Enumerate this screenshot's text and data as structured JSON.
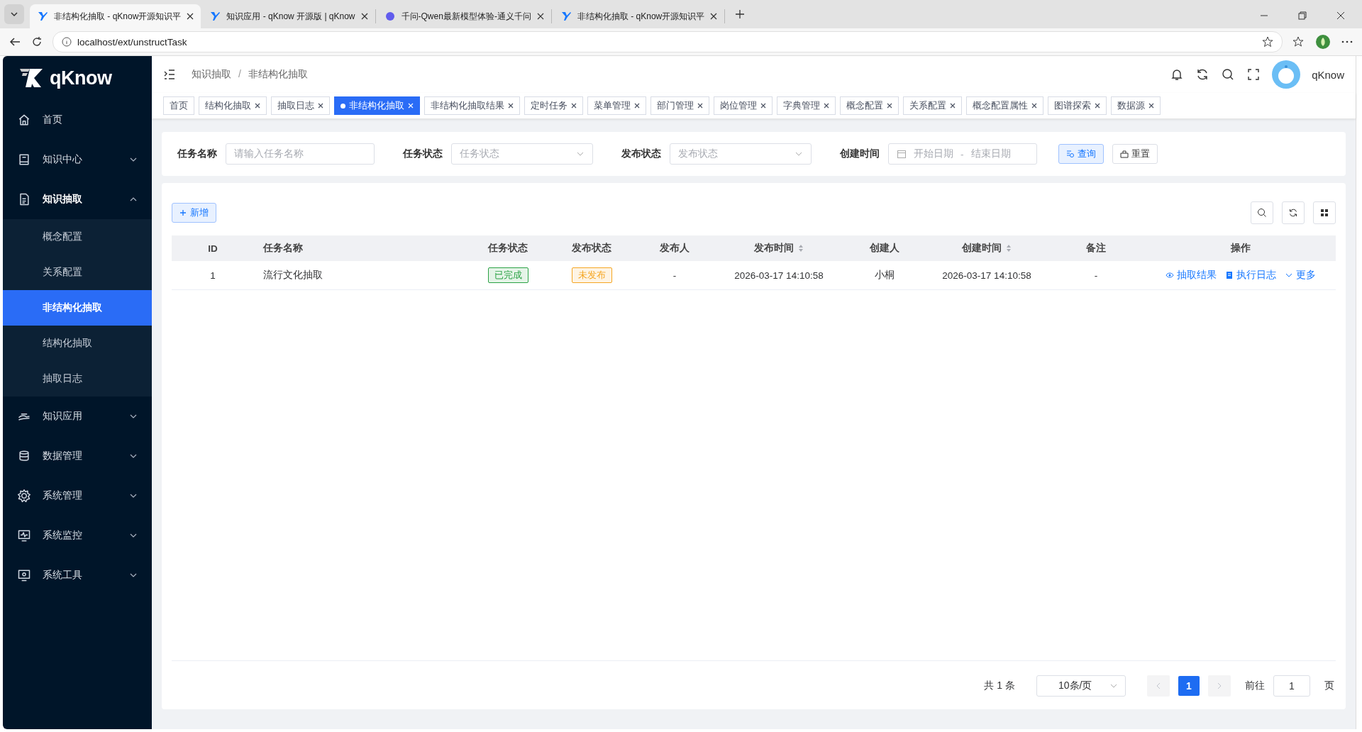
{
  "browser": {
    "tabs": [
      {
        "title": "非结构化抽取 - qKnow开源知识平",
        "selected": true
      },
      {
        "title": "知识应用 - qKnow 开源版 | qKnow",
        "selected": false
      },
      {
        "title": "千问-Qwen最新模型体验-通义千问",
        "selected": false
      },
      {
        "title": "非结构化抽取 - qKnow开源知识平",
        "selected": false
      }
    ],
    "url": "localhost/ext/unstructTask"
  },
  "sidebar": {
    "logo": "qKnow",
    "items": [
      {
        "label": "首页"
      },
      {
        "label": "知识中心",
        "expanded": false
      },
      {
        "label": "知识抽取",
        "expanded": true,
        "children": [
          {
            "label": "概念配置",
            "selected": false
          },
          {
            "label": "关系配置",
            "selected": false
          },
          {
            "label": "非结构化抽取",
            "selected": true
          },
          {
            "label": "结构化抽取",
            "selected": false
          },
          {
            "label": "抽取日志",
            "selected": false
          }
        ]
      },
      {
        "label": "知识应用",
        "expanded": false
      },
      {
        "label": "数据管理",
        "expanded": false
      },
      {
        "label": "系统管理",
        "expanded": false
      },
      {
        "label": "系统监控",
        "expanded": false
      },
      {
        "label": "系统工具",
        "expanded": false
      }
    ]
  },
  "header": {
    "breadcrumb": [
      "知识抽取",
      "非结构化抽取"
    ],
    "breadcrumb_separator": "/",
    "user": "qKnow"
  },
  "tags": [
    {
      "label": "首页",
      "selected": false,
      "closable": false
    },
    {
      "label": "结构化抽取",
      "selected": false,
      "closable": true
    },
    {
      "label": "抽取日志",
      "selected": false,
      "closable": true
    },
    {
      "label": "非结构化抽取",
      "selected": true,
      "closable": true
    },
    {
      "label": "非结构化抽取结果",
      "selected": false,
      "closable": true
    },
    {
      "label": "定时任务",
      "selected": false,
      "closable": true
    },
    {
      "label": "菜单管理",
      "selected": false,
      "closable": true
    },
    {
      "label": "部门管理",
      "selected": false,
      "closable": true
    },
    {
      "label": "岗位管理",
      "selected": false,
      "closable": true
    },
    {
      "label": "字典管理",
      "selected": false,
      "closable": true
    },
    {
      "label": "概念配置",
      "selected": false,
      "closable": true
    },
    {
      "label": "关系配置",
      "selected": false,
      "closable": true
    },
    {
      "label": "概念配置属性",
      "selected": false,
      "closable": true
    },
    {
      "label": "图谱探索",
      "selected": false,
      "closable": true
    },
    {
      "label": "数据源",
      "selected": false,
      "closable": true
    }
  ],
  "search": {
    "fields": [
      {
        "kind": "text",
        "label": "任务名称",
        "placeholder": "请输入任务名称"
      },
      {
        "kind": "select",
        "label": "任务状态",
        "placeholder": "任务状态"
      },
      {
        "kind": "select",
        "label": "发布状态",
        "placeholder": "发布状态"
      },
      {
        "kind": "daterange",
        "label": "创建时间",
        "start_placeholder": "开始日期",
        "separator": "-",
        "end_placeholder": "结束日期"
      }
    ],
    "buttons": [
      {
        "label": "查询",
        "kind": "primary"
      },
      {
        "label": "重置",
        "kind": "default"
      }
    ]
  },
  "add_button": "新增",
  "table": {
    "columns": [
      {
        "label": "ID",
        "sortable": false
      },
      {
        "label": "任务名称",
        "sortable": false
      },
      {
        "label": "任务状态",
        "sortable": false
      },
      {
        "label": "发布状态",
        "sortable": false
      },
      {
        "label": "发布人",
        "sortable": false
      },
      {
        "label": "发布时间",
        "sortable": true
      },
      {
        "label": "创建人",
        "sortable": false
      },
      {
        "label": "创建时间",
        "sortable": true
      },
      {
        "label": "备注",
        "sortable": false
      },
      {
        "label": "操作",
        "sortable": false
      }
    ],
    "rows": [
      {
        "id": "1",
        "name": "流行文化抽取",
        "task_status": {
          "text": "已完成",
          "color": "#2ba245"
        },
        "publish_status": {
          "text": "未发布",
          "color": "#f5a623"
        },
        "publisher": "-",
        "publish_time": "2026-03-17 14:10:58",
        "creator": "小桐",
        "create_time": "2026-03-17 14:10:58",
        "remark": "-",
        "actions": [
          "抽取结果",
          "执行日志",
          "更多"
        ]
      }
    ]
  },
  "pagination": {
    "total": "共 1 条",
    "page_size": "10条/页",
    "pages": [
      {
        "label": "1",
        "selected": true
      }
    ],
    "jump_label": "前往",
    "jump_value": "1",
    "jump_suffix": "页"
  }
}
